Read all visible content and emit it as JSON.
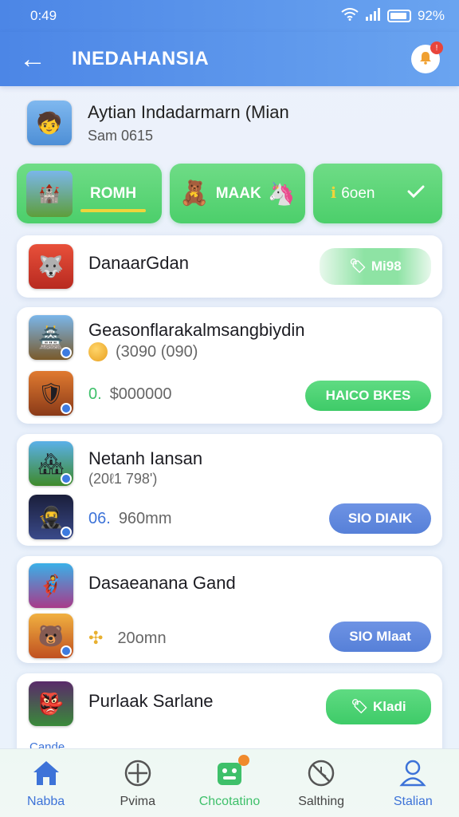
{
  "status_bar": {
    "time": "0:49",
    "battery": "92%"
  },
  "app_bar": {
    "back_glyph": "←",
    "title": "INEDAHANSIA"
  },
  "profile": {
    "name": "Aytian Indadarmarn (Mian",
    "subtitle": "Sam 0615"
  },
  "categories": [
    {
      "label": "ROMH"
    },
    {
      "label": "MAAK"
    },
    {
      "label": "6oen",
      "prefix": "ℹ"
    }
  ],
  "cards": [
    {
      "name": "DanaarGdan",
      "button": "Mi98"
    },
    {
      "name": "Geasonflarakalmsangbiydin",
      "rating": "(3090 (090)",
      "price_prefix": "0.",
      "price": "$000000",
      "button": "HAICO BKES"
    },
    {
      "name": "Netanh Iansan",
      "sub": "(20ℓ1 798')",
      "price_prefix": "06.",
      "price": "960mm",
      "button": "SIO DIAIK"
    },
    {
      "name": "Dasaeanana Gand",
      "price": "20omn",
      "button": "SIO Mlaat"
    },
    {
      "name": "Purlaak Sarlane",
      "button": "Kladi",
      "truncated": "Cande"
    }
  ],
  "bottom_nav": [
    {
      "label": "Nabba"
    },
    {
      "label": "Pvima"
    },
    {
      "label": "Chcotatino"
    },
    {
      "label": "Salthing"
    },
    {
      "label": "Stalian"
    }
  ]
}
